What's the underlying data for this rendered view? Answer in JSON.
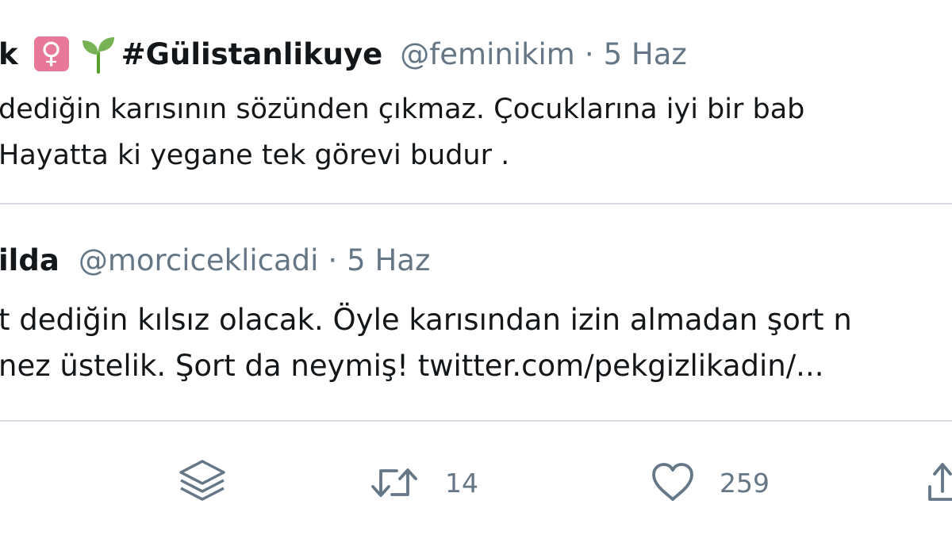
{
  "tweet": {
    "name": "k",
    "badge_symbol": "♀",
    "hashtag": "#Gülistanlikuye",
    "handle": "@feminikim",
    "separator": "·",
    "date": "5 Haz",
    "text_line1": "dediğin karısının sözünden çıkmaz. Çocuklarına iyi bir bab",
    "text_line2": "Hayatta ki yegane tek görevi budur .",
    "icons": [
      "female-sign-icon",
      "seedling-icon"
    ],
    "badge_color": "#e8789a"
  },
  "quoted_tweet": {
    "name": "ilda",
    "handle": "@morciceklicadi",
    "separator": "·",
    "date": "5 Haz",
    "text_line1": "t dediğin kılsız olacak. Öyle karısından izin almadan şort n",
    "text_line2": "nez üstelik. Şort da neymiş! twitter.com/pekgizlikadin/..."
  },
  "actions": {
    "retweet_count": "14",
    "like_count": "259",
    "icons": [
      "stack-icon",
      "retweet-icon",
      "heart-icon",
      "share-icon"
    ]
  },
  "colors": {
    "text": "#14171a",
    "secondary": "#657786",
    "divider": "#d4dadf"
  }
}
